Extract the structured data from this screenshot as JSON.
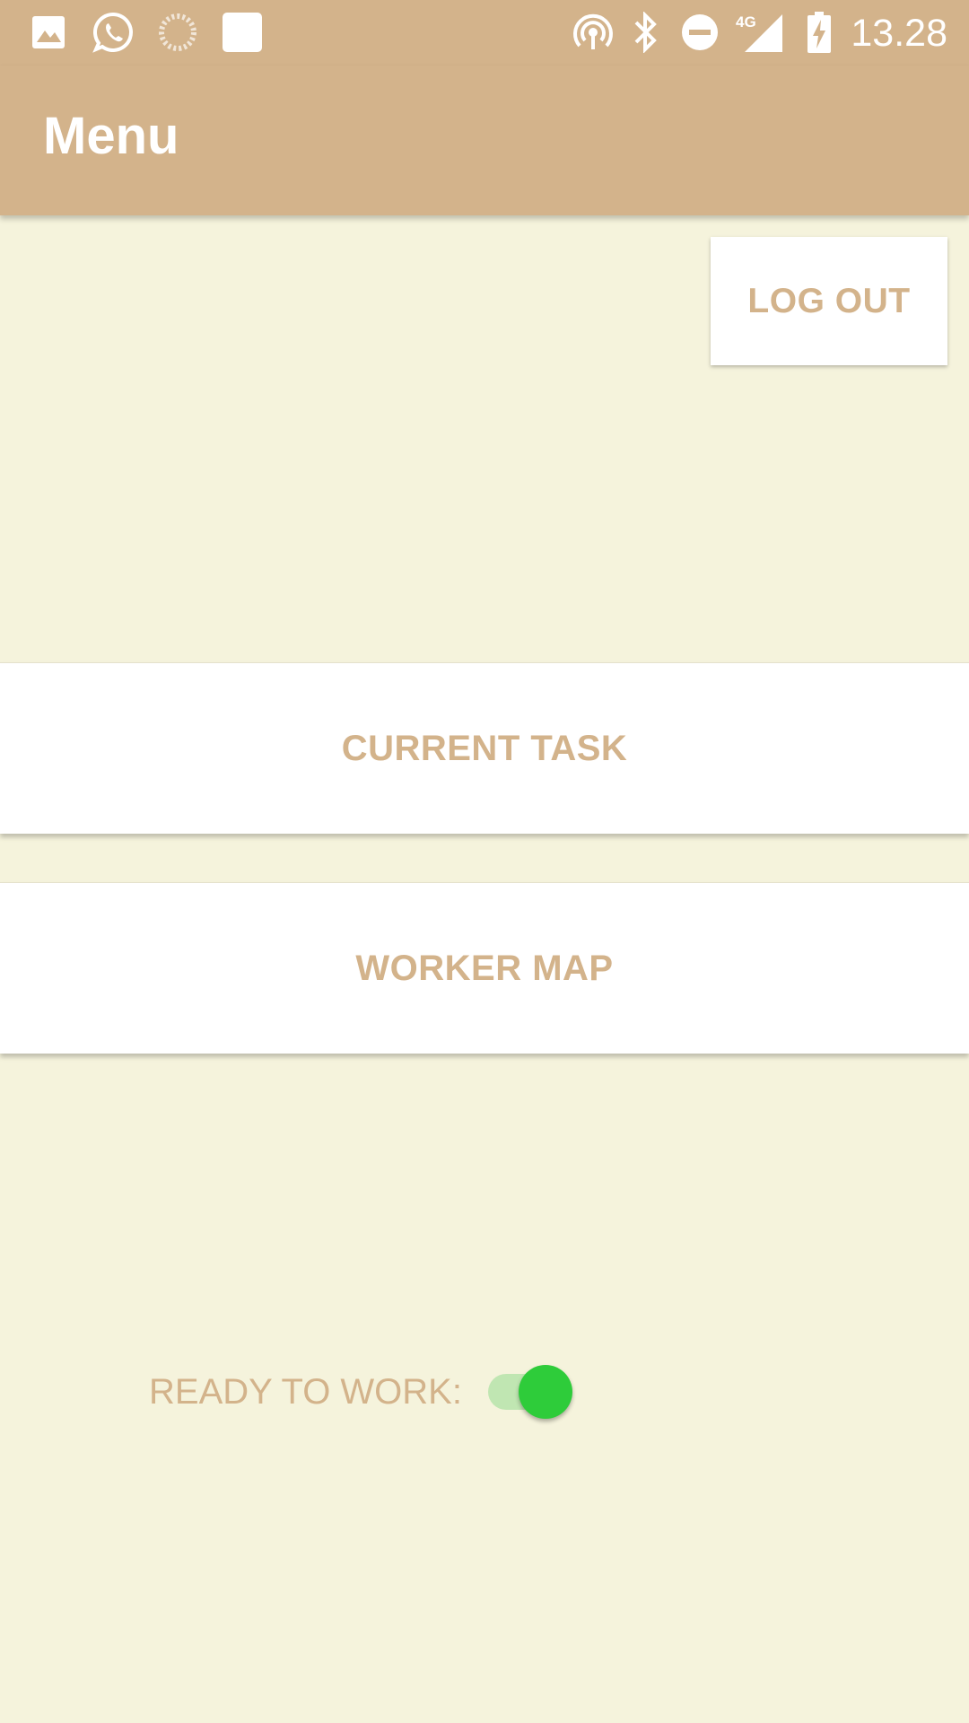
{
  "status_bar": {
    "time": "13.28",
    "network_type": "4G",
    "left_icons": [
      "image-icon",
      "whatsapp-icon",
      "loading-icon",
      "square-notification-icon"
    ],
    "right_icons": [
      "hotspot-icon",
      "bluetooth-icon",
      "do-not-disturb-icon",
      "signal-4g-icon",
      "battery-charging-icon"
    ]
  },
  "app_bar": {
    "title": "Menu"
  },
  "actions": {
    "logout_label": "LOG OUT"
  },
  "menu": {
    "current_task_label": "CURRENT TASK",
    "worker_map_label": "WORKER MAP"
  },
  "ready": {
    "label": "READY TO WORK:",
    "enabled": true
  },
  "colors": {
    "primary": "#d3b38b",
    "background": "#f5f3dc",
    "button_background": "#ffffff",
    "toggle_thumb": "#2ecc3a",
    "toggle_track": "#c0e6b2"
  }
}
